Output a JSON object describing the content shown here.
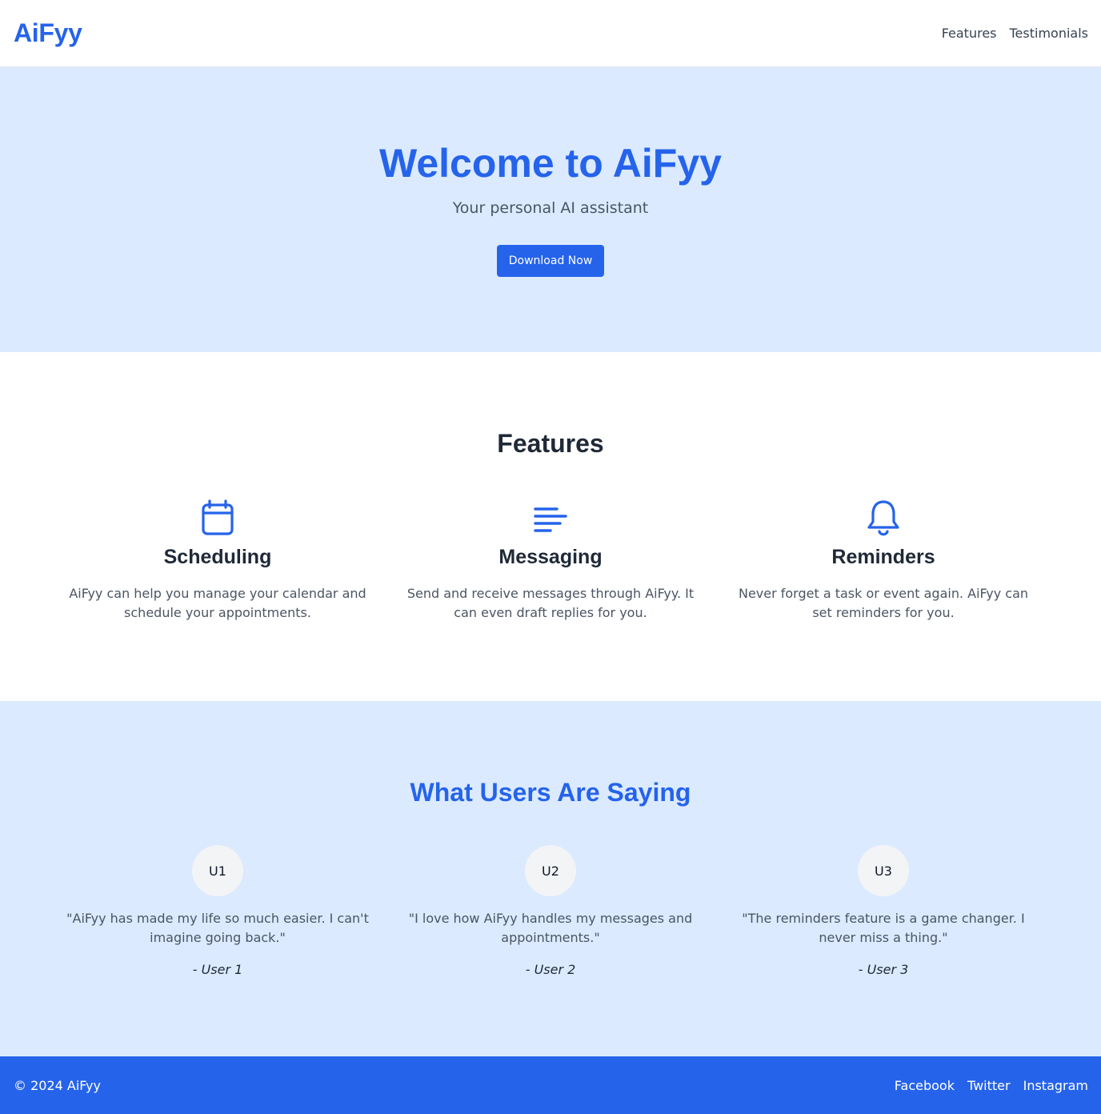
{
  "header": {
    "logo": "AiFyy",
    "nav": [
      {
        "label": "Features"
      },
      {
        "label": "Testimonials"
      }
    ]
  },
  "hero": {
    "title": "Welcome to AiFyy",
    "subtitle": "Your personal AI assistant",
    "cta_label": "Download Now"
  },
  "features": {
    "title": "Features",
    "items": [
      {
        "icon": "calendar-icon",
        "name": "Scheduling",
        "description": "AiFyy can help you manage your calendar and schedule your appointments."
      },
      {
        "icon": "message-lines-icon",
        "name": "Messaging",
        "description": "Send and receive messages through AiFyy. It can even draft replies for you."
      },
      {
        "icon": "bell-icon",
        "name": "Reminders",
        "description": "Never forget a task or event again. AiFyy can set reminders for you."
      }
    ]
  },
  "testimonials": {
    "title": "What Users Are Saying",
    "items": [
      {
        "avatar": "U1",
        "quote": "\"AiFyy has made my life so much easier. I can't imagine going back.\"",
        "author": "- User 1"
      },
      {
        "avatar": "U2",
        "quote": "\"I love how AiFyy handles my messages and appointments.\"",
        "author": "- User 2"
      },
      {
        "avatar": "U3",
        "quote": "\"The reminders feature is a game changer. I never miss a thing.\"",
        "author": "- User 3"
      }
    ]
  },
  "footer": {
    "copyright": "© 2024 AiFyy",
    "links": [
      {
        "label": "Facebook"
      },
      {
        "label": "Twitter"
      },
      {
        "label": "Instagram"
      }
    ]
  },
  "colors": {
    "accent": "#2563eb",
    "hero_background": "#dbeafe",
    "text_dark": "#1f2937",
    "text_muted": "#4b5563"
  }
}
